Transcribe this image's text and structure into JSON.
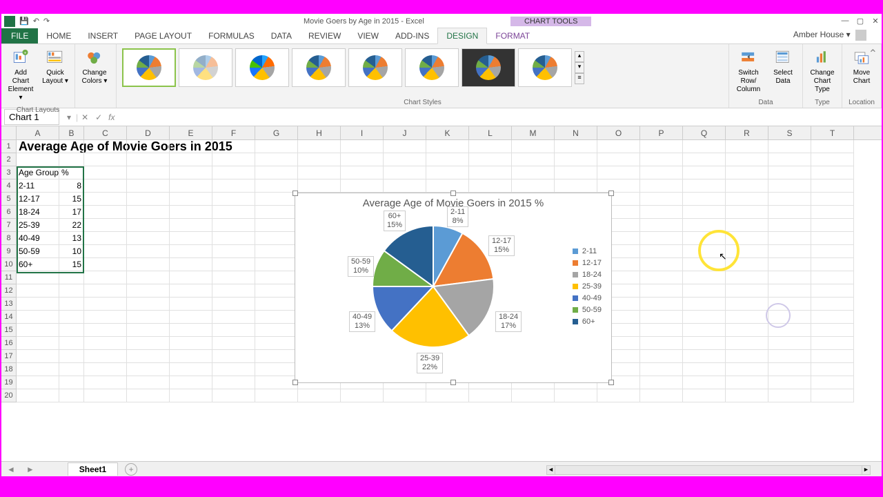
{
  "titlebar": {
    "doc_title": "Movie Goers by Age in 2015 - Excel",
    "chart_tools": "CHART TOOLS",
    "user_name": "Amber House"
  },
  "ribbon": {
    "file": "FILE",
    "tabs": [
      "HOME",
      "INSERT",
      "PAGE LAYOUT",
      "FORMULAS",
      "DATA",
      "REVIEW",
      "VIEW",
      "ADD-INS"
    ],
    "context_tabs": {
      "design": "DESIGN",
      "format": "FORMAT"
    },
    "groups": {
      "chart_layouts": "Chart Layouts",
      "chart_styles": "Chart Styles",
      "data": "Data",
      "type": "Type",
      "location": "Location"
    },
    "buttons": {
      "add_chart_element": "Add Chart Element ▾",
      "quick_layout": "Quick Layout ▾",
      "change_colors": "Change Colors ▾",
      "switch_row_col": "Switch Row/ Column",
      "select_data": "Select Data",
      "change_chart_type": "Change Chart Type",
      "move_chart": "Move Chart"
    }
  },
  "formula_bar": {
    "name_box": "Chart 1",
    "fx": "fx",
    "value": ""
  },
  "columns": [
    "A",
    "B",
    "C",
    "D",
    "E",
    "F",
    "G",
    "H",
    "I",
    "J",
    "K",
    "L",
    "M",
    "N",
    "O",
    "P",
    "Q",
    "R",
    "S",
    "T"
  ],
  "sheet": {
    "title_cell": "Average Age of Movie Goers in 2015",
    "header_A": "Age Group",
    "header_B": "%",
    "rows": [
      {
        "a": "2-11",
        "b": "8"
      },
      {
        "a": "12-17",
        "b": "15"
      },
      {
        "a": "18-24",
        "b": "17"
      },
      {
        "a": "25-39",
        "b": "22"
      },
      {
        "a": "40-49",
        "b": "13"
      },
      {
        "a": "50-59",
        "b": "10"
      },
      {
        "a": "60+",
        "b": "15"
      }
    ]
  },
  "chart_data": {
    "type": "pie",
    "title": "Average Age of Movie Goers in 2015 %",
    "categories": [
      "2-11",
      "12-17",
      "18-24",
      "25-39",
      "40-49",
      "50-59",
      "60+"
    ],
    "values": [
      8,
      15,
      17,
      22,
      13,
      10,
      15
    ],
    "colors": [
      "#5b9bd5",
      "#ed7d31",
      "#a5a5a5",
      "#ffc000",
      "#4472c4",
      "#70ad47",
      "#255e91"
    ],
    "labels": [
      {
        "text_top": "2-11",
        "text_bot": "8%"
      },
      {
        "text_top": "12-17",
        "text_bot": "15%"
      },
      {
        "text_top": "18-24",
        "text_bot": "17%"
      },
      {
        "text_top": "25-39",
        "text_bot": "22%"
      },
      {
        "text_top": "40-49",
        "text_bot": "13%"
      },
      {
        "text_top": "50-59",
        "text_bot": "10%"
      },
      {
        "text_top": "60+",
        "text_bot": "15%"
      }
    ]
  },
  "sheet_tabs": {
    "active": "Sheet1"
  }
}
